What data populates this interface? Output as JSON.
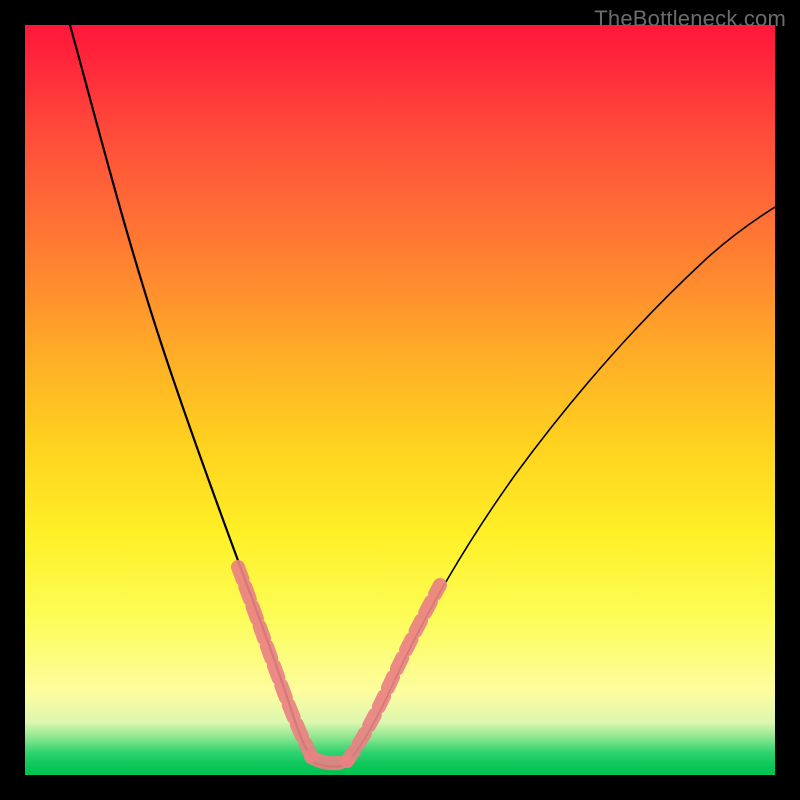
{
  "watermark": "TheBottleneck.com",
  "chart_data": {
    "type": "line",
    "title": "",
    "xlabel": "",
    "ylabel": "",
    "xlim": [
      0,
      100
    ],
    "ylim": [
      0,
      100
    ],
    "grid": false,
    "legend": false,
    "series": [
      {
        "name": "bottleneck-curve",
        "x": [
          6,
          10,
          14,
          18,
          22,
          25,
          28,
          30,
          32,
          34,
          35,
          36,
          37,
          38,
          40,
          42,
          44,
          48,
          54,
          62,
          72,
          84,
          100
        ],
        "y": [
          100,
          83,
          67,
          52,
          38,
          27,
          18,
          12,
          8,
          5,
          3,
          2,
          2,
          2,
          3,
          5,
          8,
          13,
          22,
          33,
          46,
          59,
          73
        ]
      }
    ],
    "highlight_segments": [
      {
        "name": "left-descent-beads",
        "style": "dashed-pink",
        "x": [
          25,
          28,
          30,
          32,
          34
        ],
        "y": [
          27,
          18,
          12,
          8,
          5
        ]
      },
      {
        "name": "valley-floor-beads",
        "style": "dashed-pink",
        "x": [
          34,
          36,
          38,
          40
        ],
        "y": [
          4,
          2,
          2,
          3
        ]
      },
      {
        "name": "right-ascent-beads",
        "style": "dashed-pink",
        "x": [
          40,
          42,
          44,
          46,
          48,
          51,
          54
        ],
        "y": [
          3,
          6,
          9,
          12,
          15,
          19,
          24
        ]
      }
    ],
    "background_gradient": {
      "top": "#ff173a",
      "mid_upper": "#ffad27",
      "mid_lower": "#fdfd58",
      "bottom": "#00c350"
    }
  }
}
